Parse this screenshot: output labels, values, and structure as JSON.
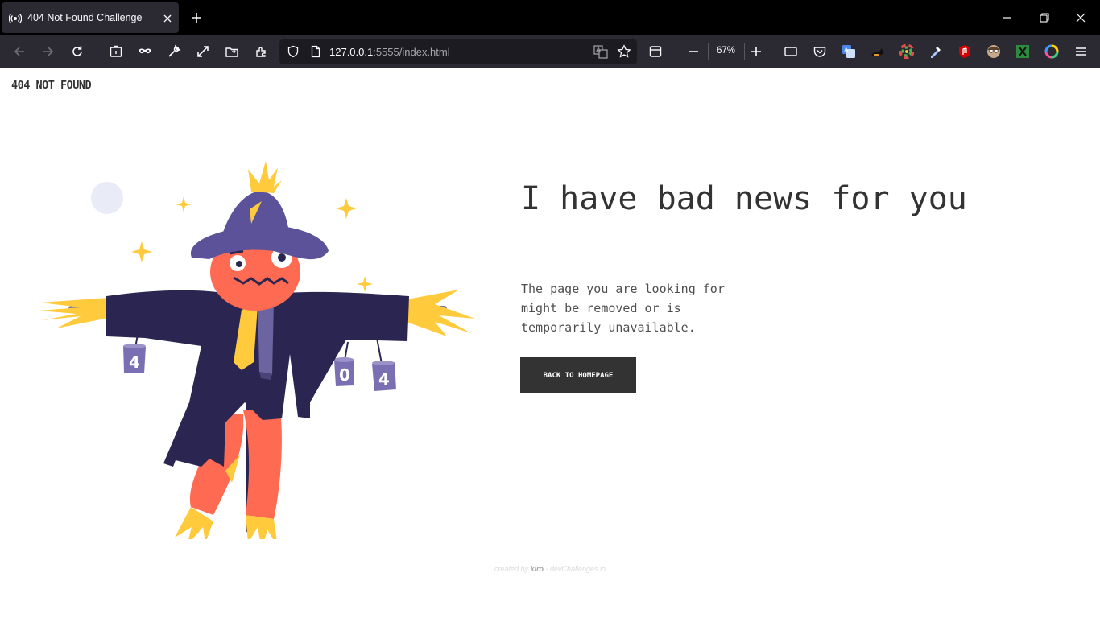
{
  "browser": {
    "tab_title": "404 Not Found Challenge",
    "url_host": "127.0.0.1",
    "url_rest": ":5555/index.html",
    "zoom": "67%"
  },
  "page": {
    "logo": "404 NOT FOUND",
    "headline": "I have bad news for you",
    "description": "The page you are looking for might be removed or is temporarily unavailable.",
    "button_label": "BACK TO HOMEPAGE",
    "cans": [
      "4",
      "0",
      "4"
    ],
    "footer": {
      "created_by": "created by",
      "author": "kiro",
      "separator": " - ",
      "site": "devChallenges.io"
    }
  },
  "colors": {
    "accent_dark": "#333333",
    "scarecrow_coat": "#2b2651",
    "scarecrow_hat": "#5b5299",
    "scarecrow_face": "#ff6a52",
    "straw": "#ffcb3d"
  }
}
